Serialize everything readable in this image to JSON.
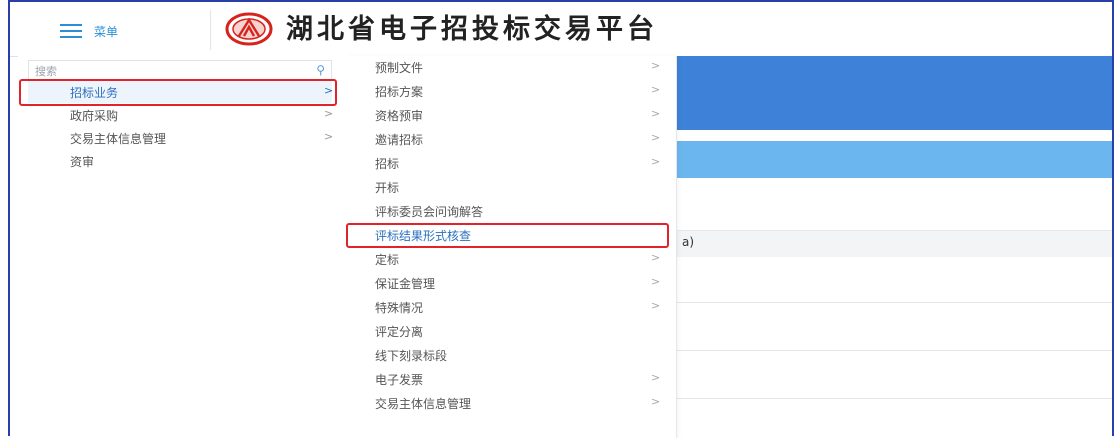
{
  "header": {
    "menu_label": "菜单",
    "title": "湖北省电子招投标交易平台"
  },
  "search": {
    "placeholder": "搜索"
  },
  "menu_level1": [
    {
      "label": "招标业务",
      "arrow": ">"
    },
    {
      "label": "政府采购",
      "arrow": ">"
    },
    {
      "label": "交易主体信息管理",
      "arrow": ">"
    },
    {
      "label": "资审",
      "arrow": ""
    }
  ],
  "menu_level2": [
    {
      "label": "预制文件",
      "arrow": ">"
    },
    {
      "label": "招标方案",
      "arrow": ">"
    },
    {
      "label": "资格预审",
      "arrow": ">"
    },
    {
      "label": "邀请招标",
      "arrow": ">"
    },
    {
      "label": "招标",
      "arrow": ">"
    },
    {
      "label": "开标",
      "arrow": ""
    },
    {
      "label": "评标委员会问询解答",
      "arrow": ""
    },
    {
      "label": "评标结果形式核查",
      "arrow": ""
    },
    {
      "label": "定标",
      "arrow": ">"
    },
    {
      "label": "保证金管理",
      "arrow": ">"
    },
    {
      "label": "特殊情况",
      "arrow": ">"
    },
    {
      "label": "评定分离",
      "arrow": ""
    },
    {
      "label": "线下刻录标段",
      "arrow": ""
    },
    {
      "label": "电子发票",
      "arrow": ">"
    },
    {
      "label": "交易主体信息管理",
      "arrow": ">"
    }
  ],
  "background": {
    "partial_text": "a)"
  },
  "colors": {
    "accent": "#2c8fd6",
    "band_dark": "#3d82d8",
    "band_light": "#6bb6ee",
    "highlight": "#e0242a"
  }
}
